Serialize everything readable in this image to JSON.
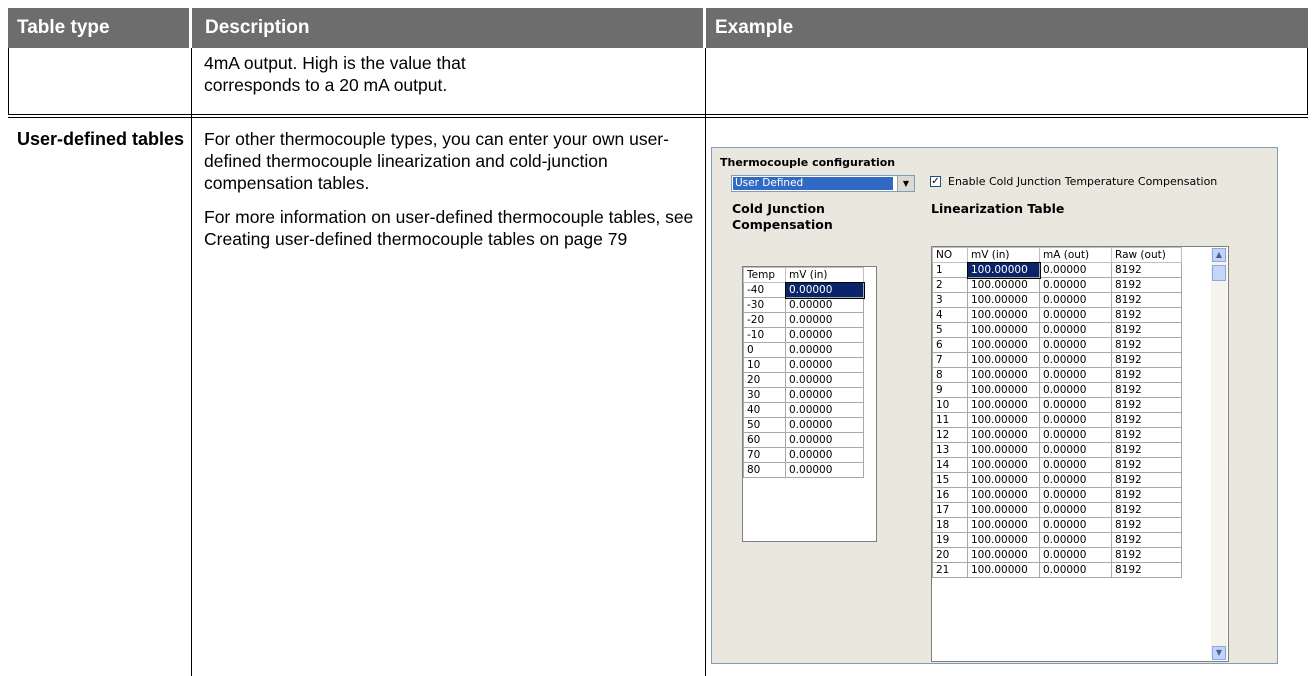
{
  "table": {
    "headers": [
      "Table type",
      "Description",
      "Example"
    ],
    "row_continued": {
      "description": "4mA output. High is the value that corresponds to a 20 mA output."
    },
    "row_user_defined": {
      "type": "User-defined tables",
      "description_p1": "For other thermocouple types, you can enter your own user-defined thermocouple linearization and cold-junction compensation tables.",
      "description_p2": "For more information on user-defined thermocouple tables, see Creating user-defined thermocouple tables on page 79"
    }
  },
  "example_window": {
    "title": "Thermocouple configuration",
    "dropdown_value": "User Defined",
    "checkbox_checked": true,
    "checkbox_label": "Enable Cold Junction Temperature Compensation",
    "cold_junction": {
      "title": "Cold Junction Compensation",
      "columns": [
        "Temp",
        "mV (in)"
      ],
      "rows": [
        [
          "-40",
          "0.00000"
        ],
        [
          "-30",
          "0.00000"
        ],
        [
          "-20",
          "0.00000"
        ],
        [
          "-10",
          "0.00000"
        ],
        [
          "0",
          "0.00000"
        ],
        [
          "10",
          "0.00000"
        ],
        [
          "20",
          "0.00000"
        ],
        [
          "30",
          "0.00000"
        ],
        [
          "40",
          "0.00000"
        ],
        [
          "50",
          "0.00000"
        ],
        [
          "60",
          "0.00000"
        ],
        [
          "70",
          "0.00000"
        ],
        [
          "80",
          "0.00000"
        ]
      ]
    },
    "linearization": {
      "title": "Linearization Table",
      "columns": [
        "NO",
        "mV (in)",
        "mA (out)",
        "Raw (out)"
      ],
      "rows": [
        [
          "1",
          "100.00000",
          "0.00000",
          "8192"
        ],
        [
          "2",
          "100.00000",
          "0.00000",
          "8192"
        ],
        [
          "3",
          "100.00000",
          "0.00000",
          "8192"
        ],
        [
          "4",
          "100.00000",
          "0.00000",
          "8192"
        ],
        [
          "5",
          "100.00000",
          "0.00000",
          "8192"
        ],
        [
          "6",
          "100.00000",
          "0.00000",
          "8192"
        ],
        [
          "7",
          "100.00000",
          "0.00000",
          "8192"
        ],
        [
          "8",
          "100.00000",
          "0.00000",
          "8192"
        ],
        [
          "9",
          "100.00000",
          "0.00000",
          "8192"
        ],
        [
          "10",
          "100.00000",
          "0.00000",
          "8192"
        ],
        [
          "11",
          "100.00000",
          "0.00000",
          "8192"
        ],
        [
          "12",
          "100.00000",
          "0.00000",
          "8192"
        ],
        [
          "13",
          "100.00000",
          "0.00000",
          "8192"
        ],
        [
          "14",
          "100.00000",
          "0.00000",
          "8192"
        ],
        [
          "15",
          "100.00000",
          "0.00000",
          "8192"
        ],
        [
          "16",
          "100.00000",
          "0.00000",
          "8192"
        ],
        [
          "17",
          "100.00000",
          "0.00000",
          "8192"
        ],
        [
          "18",
          "100.00000",
          "0.00000",
          "8192"
        ],
        [
          "19",
          "100.00000",
          "0.00000",
          "8192"
        ],
        [
          "20",
          "100.00000",
          "0.00000",
          "8192"
        ],
        [
          "21",
          "100.00000",
          "0.00000",
          "8192"
        ]
      ]
    }
  }
}
